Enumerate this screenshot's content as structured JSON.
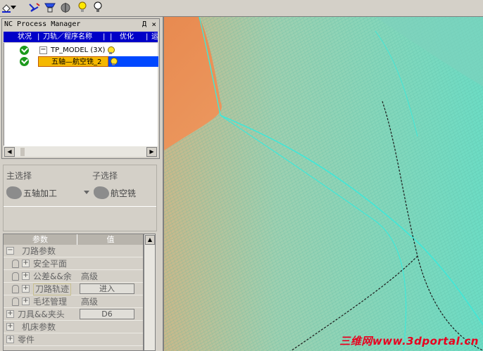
{
  "toolbar": {
    "icons": [
      "paint-bucket-icon",
      "dropdown-arrow-icon",
      "toolpath-icon",
      "machine-icon",
      "tool-holder-icon",
      "bulb-icon",
      "bulb-outline-icon"
    ]
  },
  "nc_panel": {
    "title": "NC Process Manager",
    "pin": "Д",
    "close": "×",
    "columns": [
      "状况",
      "刀轨／程序名称",
      "优化",
      "运"
    ],
    "tree": [
      {
        "label": "TP_MODEL (3X)",
        "expander": "−"
      },
      {
        "label": "五轴—航空铣_2"
      }
    ]
  },
  "selection": {
    "main_label": "主选择",
    "sub_label": "子选择",
    "main_value": "五轴加工",
    "sub_value": "航空铣"
  },
  "params": {
    "header_param": "参数",
    "header_value": "值",
    "rows": [
      {
        "label": "刀路参数",
        "expander": "−",
        "value": ""
      },
      {
        "label": "安全平面",
        "expander": "+",
        "value": ""
      },
      {
        "label": "公差&&余",
        "expander": "+",
        "value": "高级"
      },
      {
        "label": "刀路轨迹",
        "expander": "+",
        "value": "进入"
      },
      {
        "label": "毛坯管理",
        "expander": "+",
        "value": "高级"
      },
      {
        "label": "刀具&&夹头",
        "expander": "+",
        "value": "D6"
      },
      {
        "label": "机床参数",
        "expander": "+",
        "value": ""
      },
      {
        "label": "零件",
        "expander": "+",
        "value": ""
      }
    ]
  },
  "viewport": {
    "watermark": "三维网www.3dportal.cn",
    "colors": {
      "surface": "#e8925a",
      "toolpath": "#7fd6c0",
      "edge": "#40e8d8",
      "boundary": "#1a1a1a"
    }
  }
}
